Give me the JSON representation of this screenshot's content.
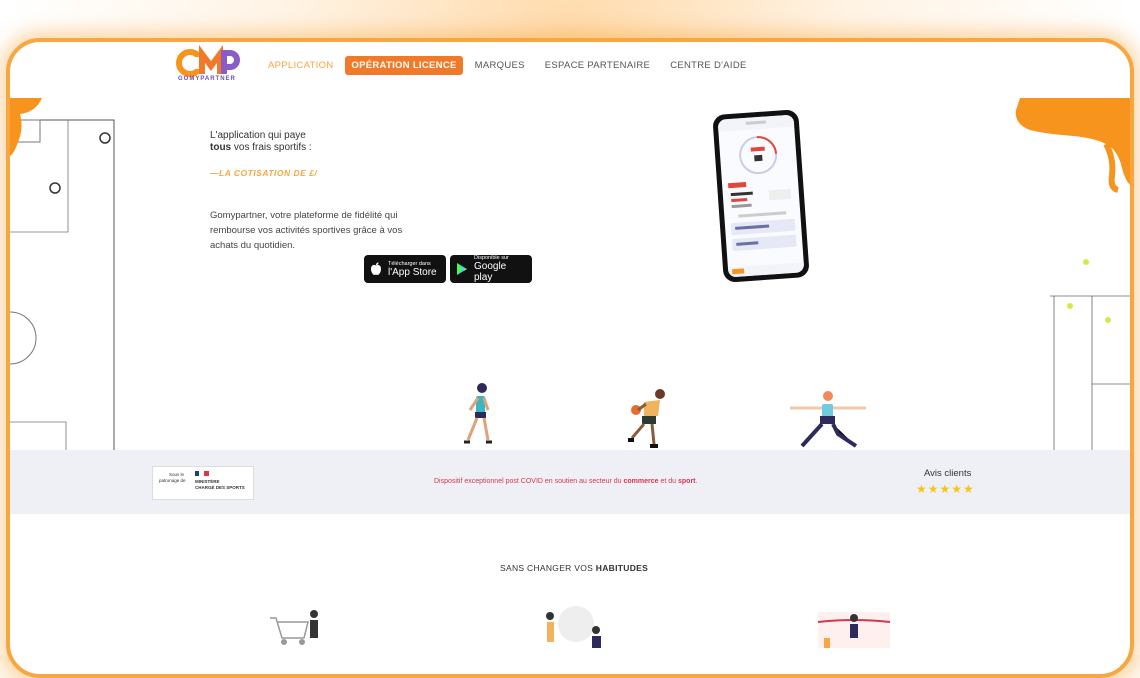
{
  "brand": {
    "logo_text": "GMP",
    "logo_sub": "GOMYPARTNER"
  },
  "nav": {
    "items": [
      {
        "label": "APPLICATION",
        "state": "active"
      },
      {
        "label": "OPÉRATION LICENCE",
        "state": "cta"
      },
      {
        "label": "MARQUES",
        "state": ""
      },
      {
        "label": "ESPACE PARTENAIRE",
        "state": ""
      },
      {
        "label": "CENTRE D'AIDE",
        "state": ""
      }
    ]
  },
  "hero": {
    "line1": "L'application qui paye",
    "line2_bold": "tous",
    "line2_rest": " vos frais sportifs :",
    "tagline": "—LA COTISATION DE £/",
    "description": "Gomypartner, votre plateforme de fidélité qui rembourse vos activités sportives grâce à vos achats du quotidien.",
    "app_store": {
      "small": "Télécharger dans",
      "big": "l'App Store"
    },
    "google_play": {
      "small": "Disponible sur",
      "big": "Google play"
    }
  },
  "strip": {
    "gov_text": {
      "label1": "Sous le",
      "label2": "patronage de",
      "label3": "MINISTÈRE",
      "label4": "CHARGÉ DES SPORTS"
    },
    "covid_pre": "Dispositif exceptionnel post COVID en soutien au secteur du ",
    "covid_b1": "commerce",
    "covid_mid": " et du ",
    "covid_b2": "sport",
    "covid_end": ".",
    "avis_label": "Avis clients",
    "stars": "★★★★★",
    "rating": 5
  },
  "section": {
    "title_pre": "SANS CHANGER VOS ",
    "title_bold": "HABITUDES"
  },
  "colors": {
    "accent": "#f7a640",
    "cta": "#f07a2a",
    "brand_purple": "#6a4fb0",
    "covid_red": "#d2384f"
  }
}
